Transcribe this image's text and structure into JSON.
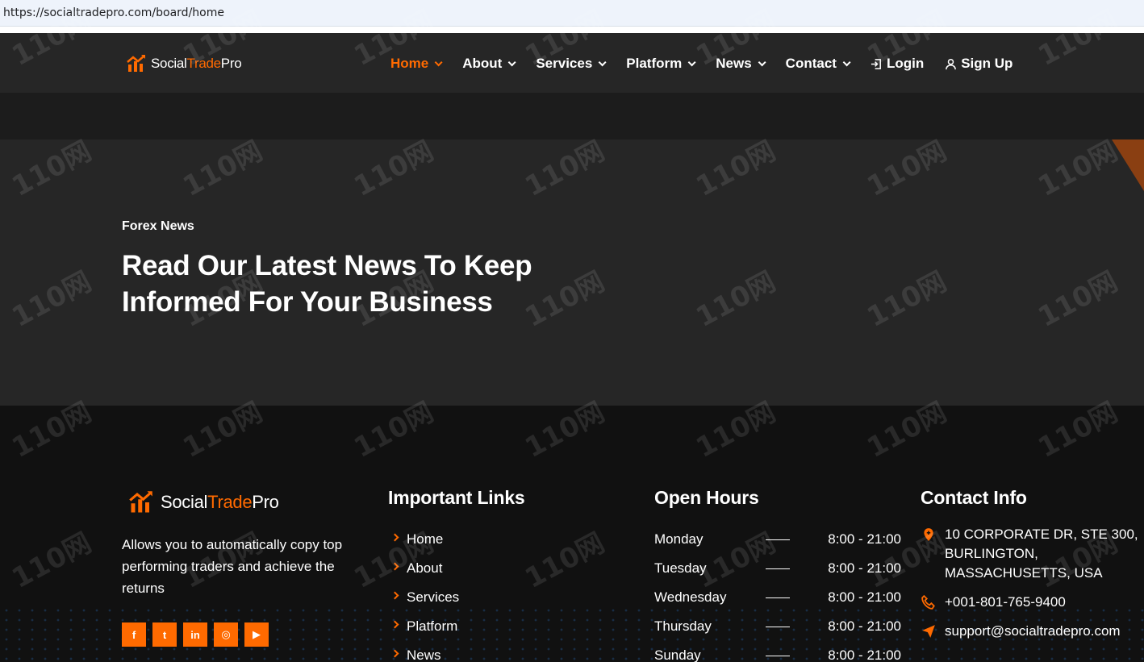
{
  "browser": {
    "url": "https://socialtradepro.com/board/home"
  },
  "brand": {
    "part1": "Social",
    "part2": "Trade",
    "part3": "Pro",
    "accent_color": "#ff6a00"
  },
  "nav": {
    "items": [
      {
        "label": "Home",
        "active": true
      },
      {
        "label": "About"
      },
      {
        "label": "Services"
      },
      {
        "label": "Platform"
      },
      {
        "label": "News"
      },
      {
        "label": "Contact"
      }
    ],
    "login": {
      "label": "Login",
      "icon": "login-icon"
    },
    "signup": {
      "label": "Sign Up",
      "icon": "user-icon"
    }
  },
  "hero": {
    "kicker": "Forex News",
    "title_line1": "Read Our Latest News To Keep",
    "title_line2": "Informed For Your Business"
  },
  "footer": {
    "about_text": "Allows you to automatically copy top performing traders and achieve the returns",
    "socials": [
      {
        "icon": "facebook-icon",
        "glyph": "f"
      },
      {
        "icon": "twitter-icon",
        "glyph": "t"
      },
      {
        "icon": "linkedin-icon",
        "glyph": "in"
      },
      {
        "icon": "instagram-icon",
        "glyph": "◎"
      },
      {
        "icon": "youtube-icon",
        "glyph": "▶"
      }
    ],
    "links_title": "Important Links",
    "links": [
      "Home",
      "About",
      "Services",
      "Platform",
      "News"
    ],
    "hours_title": "Open Hours",
    "hours": [
      {
        "day": "Monday",
        "time": "8:00 - 21:00"
      },
      {
        "day": "Tuesday",
        "time": "8:00 - 21:00"
      },
      {
        "day": "Wednesday",
        "time": "8:00 - 21:00"
      },
      {
        "day": "Thursday",
        "time": "8:00 - 21:00"
      },
      {
        "day": "Sunday",
        "time": "8:00 - 21:00"
      }
    ],
    "contact_title": "Contact Info",
    "contact": {
      "address": "10 CORPORATE DR, STE 300, BURLINGTON, MASSACHUSETTS, USA",
      "phone": "+001-801-765-9400",
      "email": "support@socialtradepro.com"
    }
  },
  "watermark": {
    "text": "110网"
  }
}
